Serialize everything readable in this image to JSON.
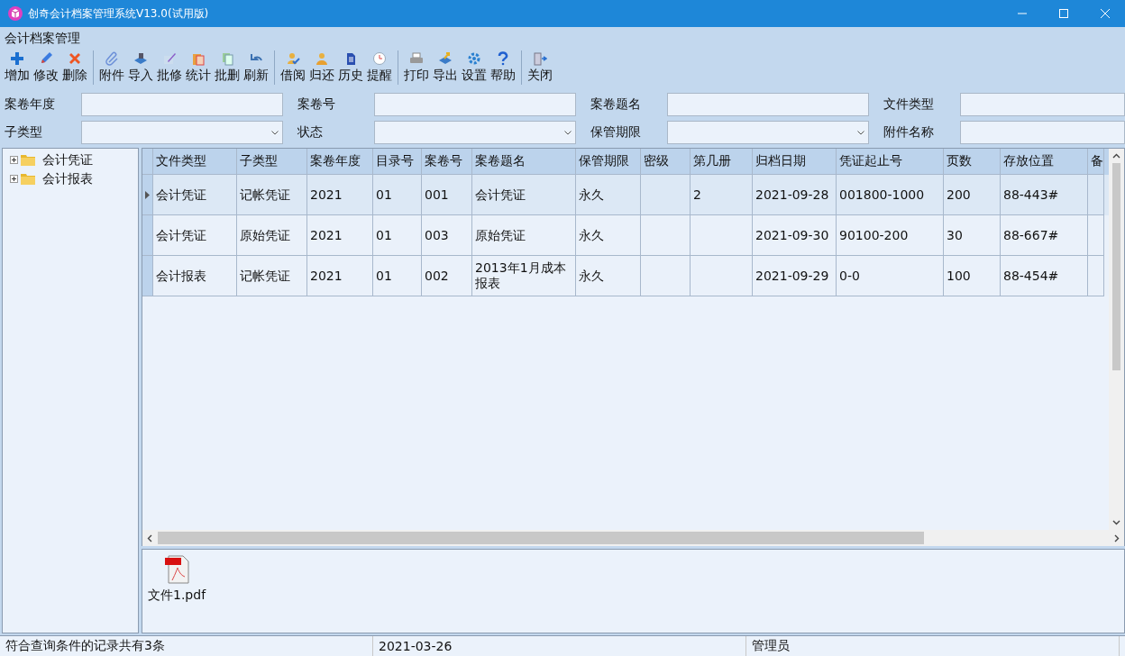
{
  "window": {
    "title": "创奇会计档案管理系统V13.0(试用版)"
  },
  "menu": {
    "title": "会计档案管理"
  },
  "toolbar": {
    "groups": [
      [
        {
          "label": "增加"
        },
        {
          "label": "修改"
        },
        {
          "label": "删除"
        }
      ],
      [
        {
          "label": "附件"
        },
        {
          "label": "导入"
        },
        {
          "label": "批修"
        },
        {
          "label": "统计"
        },
        {
          "label": "批删"
        },
        {
          "label": "刷新"
        }
      ],
      [
        {
          "label": "借阅"
        },
        {
          "label": "归还"
        },
        {
          "label": "历史"
        },
        {
          "label": "提醒"
        }
      ],
      [
        {
          "label": "打印"
        },
        {
          "label": "导出"
        },
        {
          "label": "设置"
        },
        {
          "label": "帮助"
        }
      ],
      [
        {
          "label": "关闭"
        }
      ]
    ]
  },
  "filters": [
    {
      "label": "案卷年度",
      "kind": "text"
    },
    {
      "label": "案卷号",
      "kind": "text"
    },
    {
      "label": "案卷题名",
      "kind": "text"
    },
    {
      "label": "文件类型",
      "kind": "text"
    },
    {
      "label": "子类型",
      "kind": "combo"
    },
    {
      "label": "状态",
      "kind": "combo"
    },
    {
      "label": "保管期限",
      "kind": "combo"
    },
    {
      "label": "附件名称",
      "kind": "text"
    }
  ],
  "tree": {
    "items": [
      {
        "label": "会计凭证",
        "expanded": false
      },
      {
        "label": "会计报表",
        "expanded": false
      }
    ]
  },
  "table": {
    "columns": [
      "文件类型",
      "子类型",
      "案卷年度",
      "目录号",
      "案卷号",
      "案卷题名",
      "保管期限",
      "密级",
      "第几册",
      "归档日期",
      "凭证起止号",
      "页数",
      "存放位置",
      "备"
    ],
    "rows": [
      {
        "selected": true,
        "cells": [
          "会计凭证",
          "记帐凭证",
          "2021",
          "01",
          "001",
          "会计凭证",
          "永久",
          null,
          "2",
          "2021-09-28",
          "001800-1000",
          "200",
          "88-443#",
          null
        ]
      },
      {
        "selected": false,
        "cells": [
          "会计凭证",
          "原始凭证",
          "2021",
          "01",
          "003",
          "原始凭证",
          "永久",
          null,
          null,
          "2021-09-30",
          "90100-200",
          "30",
          "88-667#",
          null
        ]
      },
      {
        "selected": false,
        "cells": [
          "会计报表",
          "记帐凭证",
          "2021",
          "01",
          "002",
          "2013年1月成本报表",
          "永久",
          null,
          null,
          "2021-09-29",
          "0-0",
          "100",
          "88-454#",
          null
        ]
      }
    ]
  },
  "attachments": [
    {
      "name": "文件1.pdf"
    }
  ],
  "status_bar": [
    "符合查询条件的记录共有3条",
    "2021-03-26",
    "管理员"
  ]
}
